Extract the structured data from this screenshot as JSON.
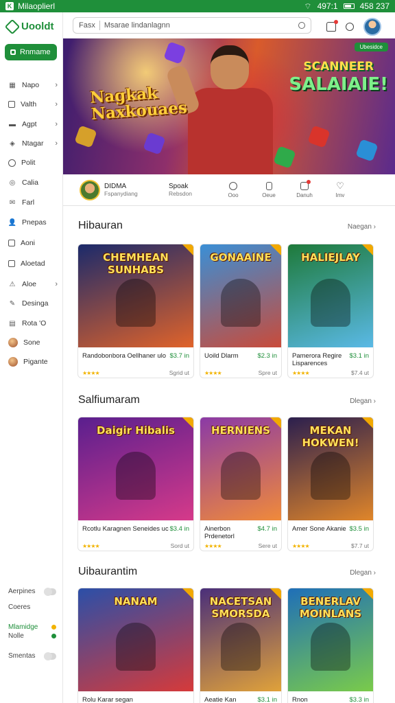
{
  "status_bar": {
    "app": "Milaoplierl",
    "battery": "497:1",
    "time": "458 237"
  },
  "sidebar": {
    "brand": "Uooldt",
    "active": {
      "label": "Rnmame"
    },
    "items": [
      {
        "label": "Napo",
        "icon": "grid-icon",
        "chevron": true
      },
      {
        "label": "Valth",
        "icon": "box-icon",
        "chevron": true
      },
      {
        "label": "Agpt",
        "icon": "folder-icon",
        "chevron": true
      },
      {
        "label": "Ntagar",
        "icon": "tag-icon",
        "chevron": true
      },
      {
        "label": "Polit",
        "icon": "circle-icon",
        "chevron": false
      },
      {
        "label": "Calia",
        "icon": "gear-icon",
        "chevron": false
      },
      {
        "label": "Farl",
        "icon": "mail-icon",
        "chevron": false
      },
      {
        "label": "Pnepas",
        "icon": "users-icon",
        "chevron": false
      },
      {
        "label": "Aoni",
        "icon": "book-icon",
        "chevron": false
      },
      {
        "label": "Aloetad",
        "icon": "checkbox-icon",
        "chevron": false
      },
      {
        "label": "Aloe",
        "icon": "bell-icon",
        "chevron": true
      },
      {
        "label": "Desinga",
        "icon": "pen-icon",
        "chevron": false
      },
      {
        "label": "Rota 'O",
        "icon": "calendar-icon",
        "chevron": false
      },
      {
        "label": "Sone",
        "icon": "avatar-icon",
        "chevron": false
      },
      {
        "label": "Pigante",
        "icon": "avatar-icon",
        "chevron": false
      }
    ],
    "bottom": [
      {
        "label": "Aerpines",
        "control": "toggle"
      },
      {
        "label": "Coeres",
        "control": "none"
      },
      {
        "label": "Mlamidge",
        "control": "dot",
        "color": "#f2b300",
        "emphasis": true
      },
      {
        "label": "Nolle",
        "control": "dot",
        "color": "#1f8f3a"
      },
      {
        "label": "Smentas",
        "control": "toggle"
      }
    ]
  },
  "header": {
    "search_prefix": "Fasx",
    "search_placeholder": "Msarae lindanlagnn"
  },
  "hero": {
    "left_title": [
      "Nagkak",
      "Naxkouaes"
    ],
    "right_title": [
      "SCANNEER",
      "SALAIAIE!"
    ],
    "badge": "Ubesidce"
  },
  "quickbar": {
    "profile_name": "DIDMA",
    "profile_sub": "Fspanydiang",
    "col_title": "Spoak",
    "col_sub": "Rebsdon",
    "icons": [
      {
        "label": "Ooo",
        "icon": "search-icon"
      },
      {
        "label": "Oeue",
        "icon": "phone-icon"
      },
      {
        "label": "Danuh",
        "icon": "inbox-icon",
        "badge": true
      },
      {
        "label": "Imv",
        "icon": "heart-icon"
      }
    ]
  },
  "sections": [
    {
      "title": "Hibauran",
      "link": "Naegan",
      "cards": [
        {
          "art_title": "CHEMHEAN SUNHABS",
          "name": "Randobonbora Oellhaner ulo",
          "price": "$3.7 in",
          "meta": "Sgrid ut",
          "colors": [
            "#1b2a6b",
            "#e0632a"
          ]
        },
        {
          "art_title": "GONAAINE",
          "name": "Uoild Dlarm",
          "price": "$2.3 in",
          "meta": "Spre ut",
          "colors": [
            "#3a8fd6",
            "#c94b3a"
          ]
        },
        {
          "art_title": "HALIEJLAY",
          "name": "Pamerora Regire Lisparences",
          "price": "$3.1 in",
          "meta": "$7.4 ut",
          "colors": [
            "#1e7a3a",
            "#5ab9e6"
          ]
        }
      ]
    },
    {
      "title": "Salfiumaram",
      "link": "Dlegan",
      "cards": [
        {
          "art_title": "Daigir Hibalis",
          "name": "Rcotlu Karagnen Seneides uc",
          "price": "$3.4 in",
          "meta": "Sord ut",
          "colors": [
            "#5a1f8e",
            "#d63a8a"
          ]
        },
        {
          "art_title": "HERNIENS",
          "name": "Ainerbon Prdenetorl",
          "price": "$4.7 in",
          "meta": "Sere ut",
          "colors": [
            "#8b3aa6",
            "#f08a3a"
          ]
        },
        {
          "art_title": "MEKAN HOKWEN!",
          "name": "Amer Sone Akanie",
          "price": "$3.5 in",
          "meta": "$7.7 ut",
          "colors": [
            "#2b1f4e",
            "#e0862a"
          ]
        }
      ]
    },
    {
      "title": "Uibaurantim",
      "link": "Dlegan",
      "cards": [
        {
          "art_title": "NANAM",
          "name": "Rolu Karar segan",
          "price": "",
          "meta": "",
          "colors": [
            "#2b4fa8",
            "#d63a3a"
          ]
        },
        {
          "art_title": "NACETSAN SMORSDA",
          "name": "Aeatie Kan",
          "price": "$3.1 in",
          "meta": "",
          "colors": [
            "#4a2f7a",
            "#e0a23a"
          ]
        },
        {
          "art_title": "BENERLAV MOINLANS",
          "name": "Rnon",
          "price": "$3.3 in",
          "meta": "",
          "colors": [
            "#1f6fb8",
            "#7acb4a"
          ]
        }
      ]
    }
  ]
}
